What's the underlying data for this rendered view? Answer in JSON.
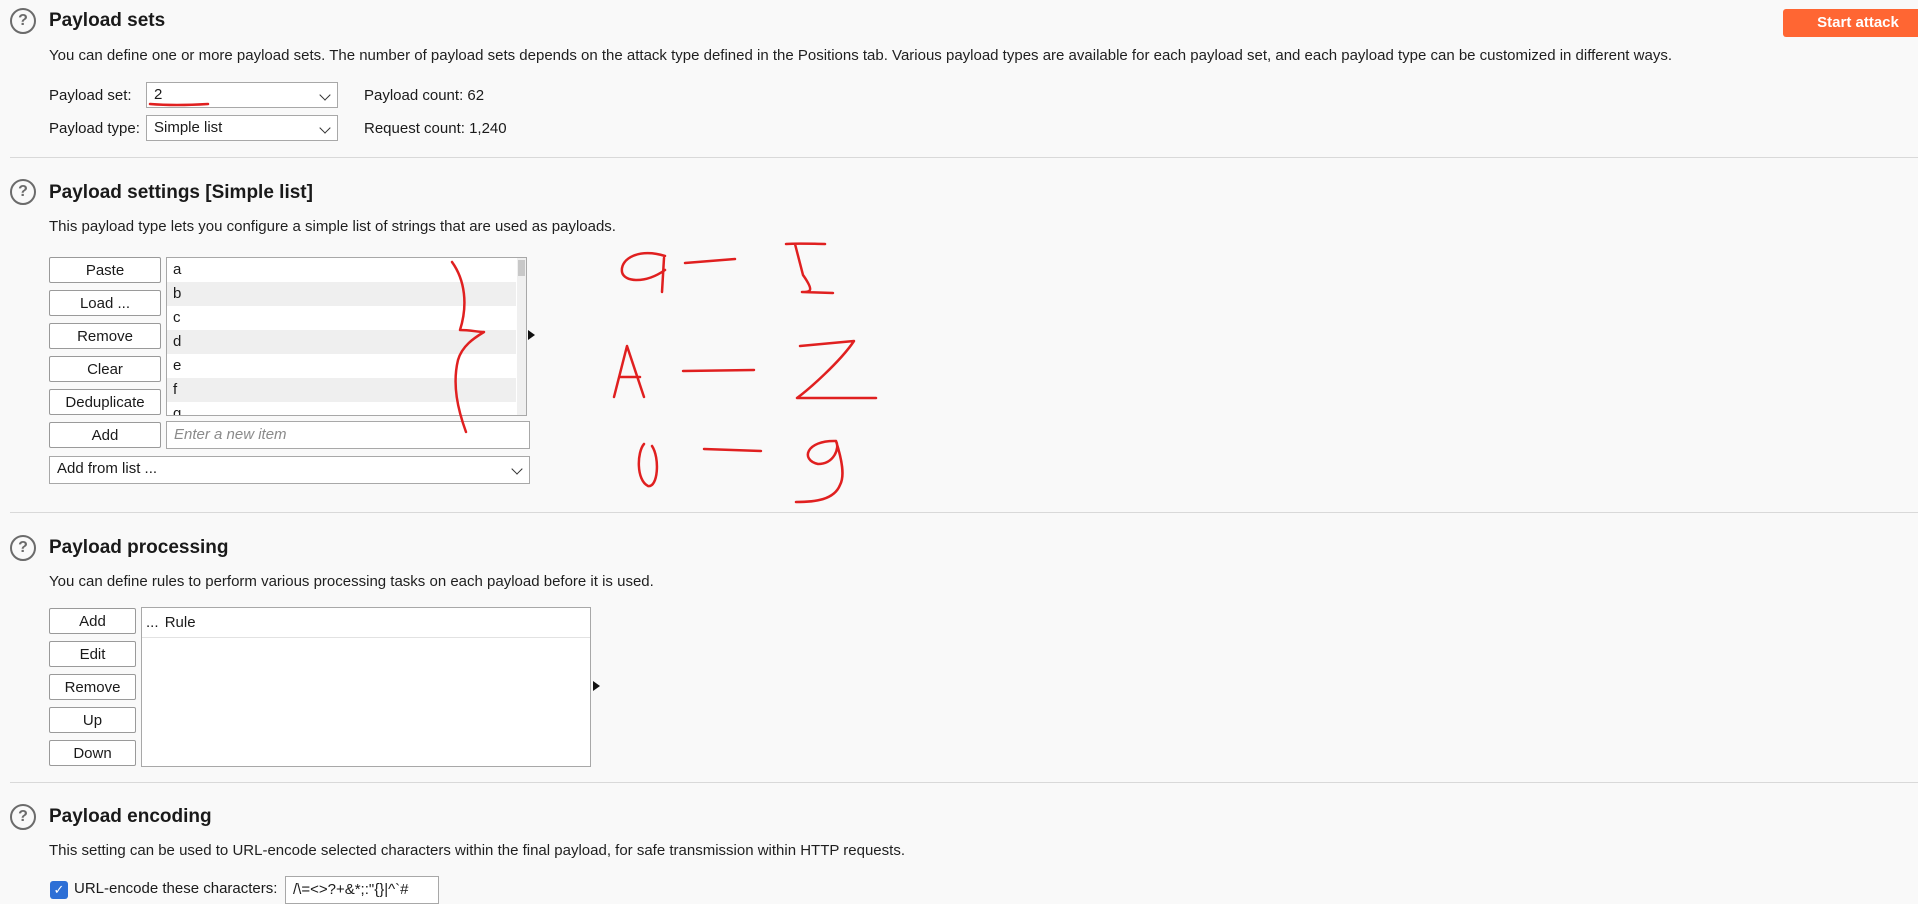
{
  "start_attack": {
    "label": "Start attack",
    "color": "#ff6633"
  },
  "payload_sets": {
    "title": "Payload sets",
    "description": "You can define one or more payload sets. The number of payload sets depends on the attack type defined in the Positions tab. Various payload types are available for each payload set, and each payload type can be customized in different ways.",
    "set_label": "Payload set:",
    "set_value": "2",
    "type_label": "Payload type:",
    "type_value": "Simple list",
    "count_label": "Payload count:",
    "count_value": "62",
    "request_label": "Request count:",
    "request_value": "1,240"
  },
  "payload_settings": {
    "title": "Payload settings [Simple list]",
    "description": "This payload type lets you configure a simple list of strings that are used as payloads.",
    "buttons": {
      "paste": "Paste",
      "load": "Load ...",
      "remove": "Remove",
      "clear": "Clear",
      "deduplicate": "Deduplicate",
      "add": "Add"
    },
    "items": [
      "a",
      "b",
      "c",
      "d",
      "e",
      "f",
      "g"
    ],
    "new_item_placeholder": "Enter a new item",
    "add_from_list": "Add from list ..."
  },
  "payload_processing": {
    "title": "Payload processing",
    "description": "You can define rules to perform various processing tasks on each payload before it is used.",
    "buttons": {
      "add": "Add",
      "edit": "Edit",
      "remove": "Remove",
      "up": "Up",
      "down": "Down"
    },
    "col_enabled": "...",
    "col_rule": "Rule"
  },
  "payload_encoding": {
    "title": "Payload encoding",
    "description": "This setting can be used to URL-encode selected characters within the final payload, for safe transmission within HTTP requests.",
    "checkbox_label": "URL-encode these characters:",
    "characters": "/\\=<>?+&*;:\"{}|^`#",
    "checked": true
  },
  "annotation": {
    "color": "#e02020",
    "ranges": [
      "a - z",
      "A - Z",
      "0 - 9"
    ]
  }
}
